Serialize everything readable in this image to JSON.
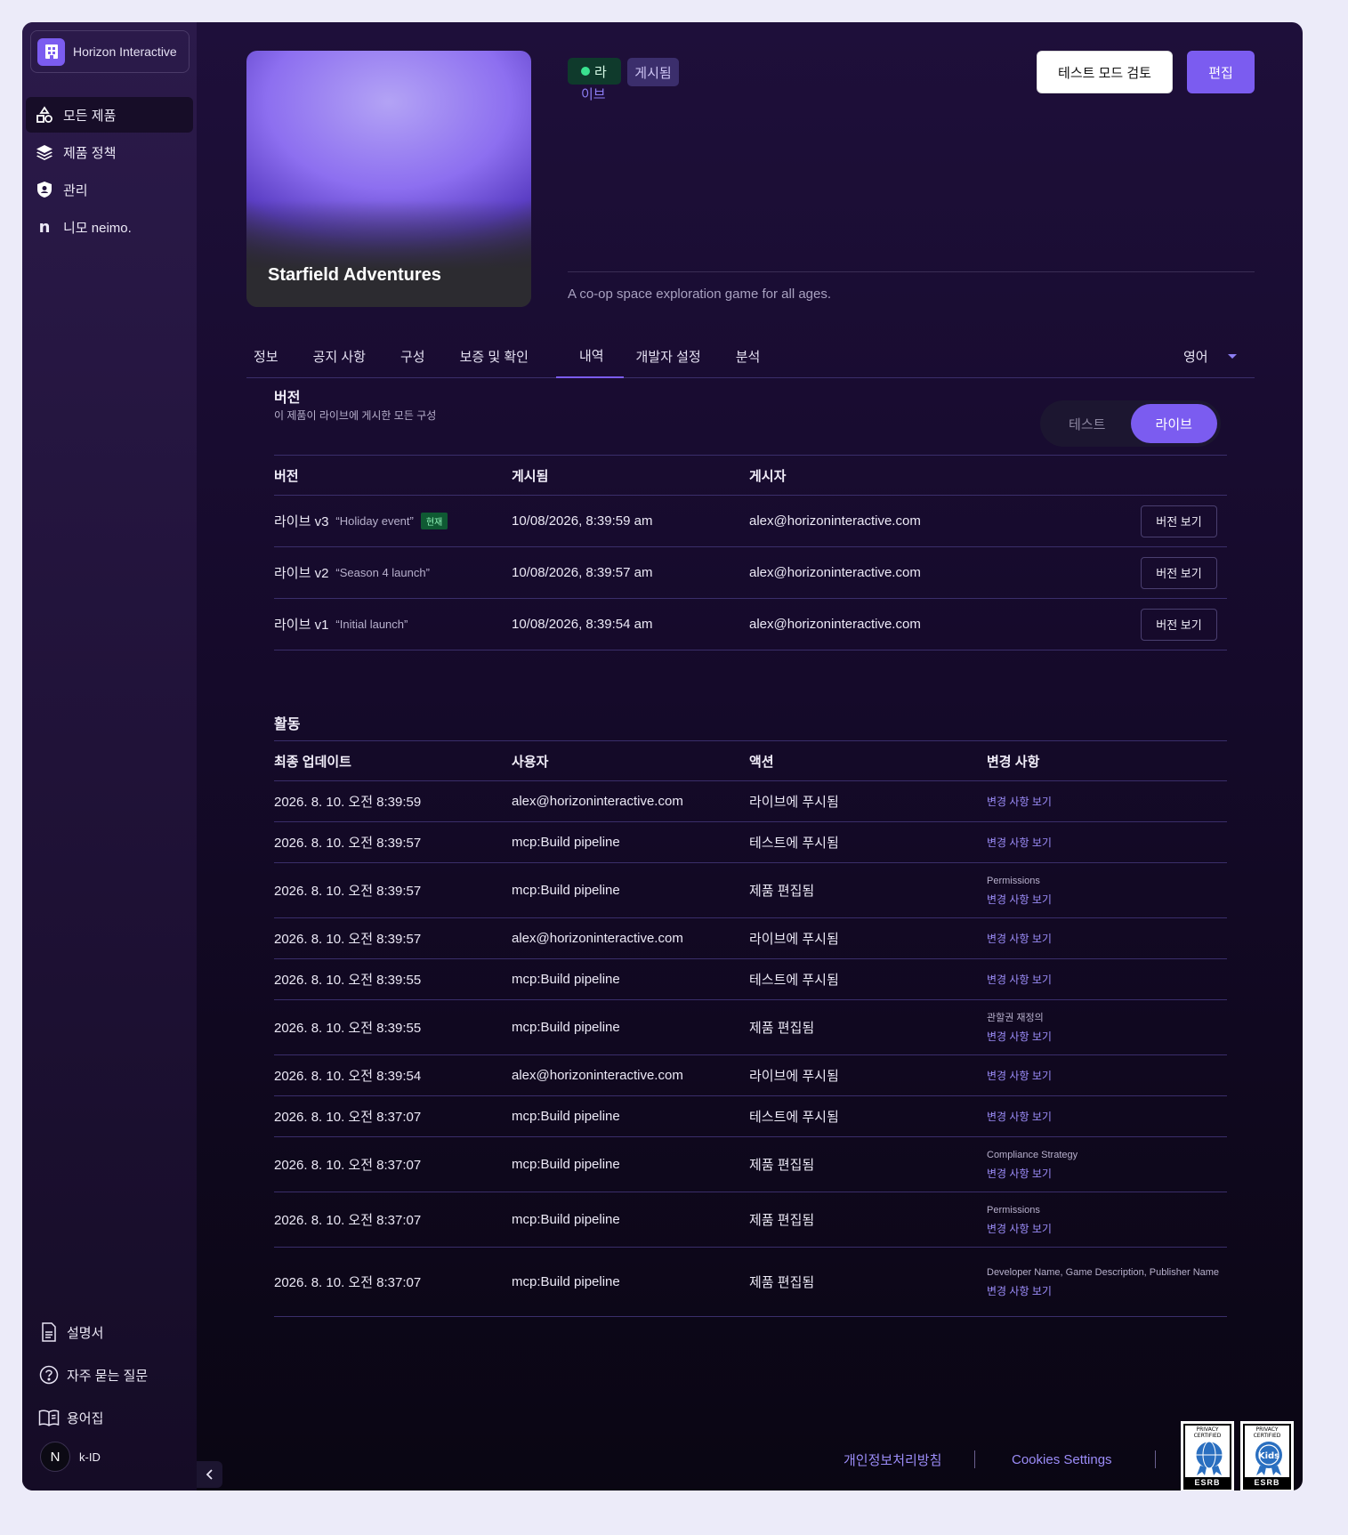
{
  "org": {
    "name": "Horizon Interactive"
  },
  "nav": [
    {
      "label": "모든 제품",
      "icon": "products-icon"
    },
    {
      "label": "제품 정책",
      "icon": "layers-icon"
    },
    {
      "label": "관리",
      "icon": "shield-icon"
    },
    {
      "label": "니모 neimo.",
      "icon": "neimo-icon"
    }
  ],
  "side_links": [
    {
      "label": "설명서",
      "icon": "document-icon"
    },
    {
      "label": "자주 묻는 질문",
      "icon": "help-circle-icon"
    },
    {
      "label": "용어집",
      "icon": "book-icon"
    }
  ],
  "kid": {
    "avatar": "N",
    "label": "k-ID"
  },
  "product": {
    "title": "Starfield Adventures",
    "description": "A co-op space exploration game for all ages.",
    "status_live_1": "라",
    "status_live_2": "이브",
    "status_published": "게시됨"
  },
  "actions": {
    "review": "테스트 모드 검토",
    "edit": "편집"
  },
  "tabs": [
    "정보",
    "공지 사항",
    "구성",
    "보증 및 확인",
    "내역",
    "개발자 설정",
    "분석"
  ],
  "active_tab": 4,
  "language": "영어",
  "versions": {
    "title": "버전",
    "subtitle": "이 제품이 라이브에 게시한 모든 구성",
    "toggle": {
      "test": "테스트",
      "live": "라이브",
      "selected": "live"
    },
    "headers": [
      "버전",
      "게시됨",
      "게시자"
    ],
    "view_label": "버전 보기",
    "rows": [
      {
        "version": "라이브 v3",
        "note": "“Holiday event”",
        "current": "현재",
        "published": "10/08/2026, 8:39:59 am",
        "by": "alex@horizoninteractive.com"
      },
      {
        "version": "라이브 v2",
        "note": "“Season 4 launch”",
        "current": "",
        "published": "10/08/2026, 8:39:57 am",
        "by": "alex@horizoninteractive.com"
      },
      {
        "version": "라이브 v1",
        "note": "“Initial launch”",
        "current": "",
        "published": "10/08/2026, 8:39:54 am",
        "by": "alex@horizoninteractive.com"
      }
    ]
  },
  "activity": {
    "title": "활동",
    "headers": [
      "최종 업데이트",
      "사용자",
      "액션",
      "변경 사항"
    ],
    "link_label": "변경 사항 보기",
    "rows": [
      {
        "time": "2026. 8. 10. 오전 8:39:59",
        "user": "alex@horizoninteractive.com",
        "action": "라이브에 푸시됨",
        "detail": ""
      },
      {
        "time": "2026. 8. 10. 오전 8:39:57",
        "user": "mcp:Build pipeline",
        "action": "테스트에 푸시됨",
        "detail": ""
      },
      {
        "time": "2026. 8. 10. 오전 8:39:57",
        "user": "mcp:Build pipeline",
        "action": "제품 편집됨",
        "detail": "Permissions"
      },
      {
        "time": "2026. 8. 10. 오전 8:39:57",
        "user": "alex@horizoninteractive.com",
        "action": "라이브에 푸시됨",
        "detail": ""
      },
      {
        "time": "2026. 8. 10. 오전 8:39:55",
        "user": "mcp:Build pipeline",
        "action": "테스트에 푸시됨",
        "detail": ""
      },
      {
        "time": "2026. 8. 10. 오전 8:39:55",
        "user": "mcp:Build pipeline",
        "action": "제품 편집됨",
        "detail": "관할권 재정의"
      },
      {
        "time": "2026. 8. 10. 오전 8:39:54",
        "user": "alex@horizoninteractive.com",
        "action": "라이브에 푸시됨",
        "detail": ""
      },
      {
        "time": "2026. 8. 10. 오전 8:37:07",
        "user": "mcp:Build pipeline",
        "action": "테스트에 푸시됨",
        "detail": ""
      },
      {
        "time": "2026. 8. 10. 오전 8:37:07",
        "user": "mcp:Build pipeline",
        "action": "제품 편집됨",
        "detail": "Compliance Strategy"
      },
      {
        "time": "2026. 8. 10. 오전 8:37:07",
        "user": "mcp:Build pipeline",
        "action": "제품 편집됨",
        "detail": "Permissions"
      },
      {
        "time": "2026. 8. 10. 오전 8:37:07",
        "user": "mcp:Build pipeline",
        "action": "제품 편집됨",
        "detail": "Developer Name, Game Description, Publisher Name"
      }
    ]
  },
  "footer": {
    "privacy": "개인정보처리방침",
    "cookies": "Cookies Settings",
    "esrb_1": {
      "top": "PRIVACY CERTIFIED",
      "bottom": "ESRB"
    },
    "esrb_2": {
      "top": "PRIVACY CERTIFIED",
      "bottom": "ESRB",
      "inner": "Kids"
    }
  },
  "colors": {
    "accent": "#7b5cf0",
    "live_green": "#39e28f",
    "link": "#9b8cf8"
  }
}
